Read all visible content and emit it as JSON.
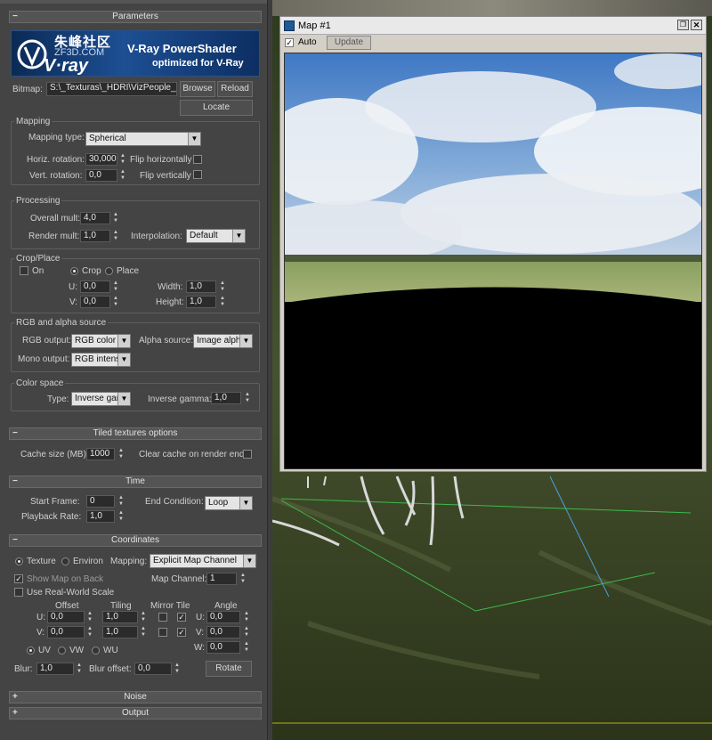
{
  "banner": {
    "brand_chinese": "朱峰社区",
    "brand_site": "ZF3D.COM",
    "logo_text": "V·ray",
    "product": "V-Ray PowerShader",
    "tagline": "optimized for V-Ray"
  },
  "parameters": {
    "header": "Parameters",
    "bitmap_label": "Bitmap:",
    "bitmap_path": "S:\\_Texturas\\_HDRI\\VizPeople_HD",
    "browse": "Browse",
    "reload": "Reload",
    "locate": "Locate"
  },
  "mapping": {
    "title": "Mapping",
    "type_label": "Mapping type:",
    "type_value": "Spherical",
    "horiz_label": "Horiz. rotation:",
    "horiz_value": "30,000",
    "flip_h": "Flip horizontally",
    "vert_label": "Vert. rotation:",
    "vert_value": "0,0",
    "flip_v": "Flip vertically"
  },
  "processing": {
    "title": "Processing",
    "overall_label": "Overall mult:",
    "overall_value": "4,0",
    "render_label": "Render mult:",
    "render_value": "1,0",
    "interp_label": "Interpolation:",
    "interp_value": "Default"
  },
  "crop": {
    "title": "Crop/Place",
    "on": "On",
    "crop": "Crop",
    "place": "Place",
    "u_label": "U:",
    "u_value": "0,0",
    "v_label": "V:",
    "v_value": "0,0",
    "width_label": "Width:",
    "width_value": "1,0",
    "height_label": "Height:",
    "height_value": "1,0"
  },
  "rgb": {
    "title": "RGB and alpha source",
    "rgb_label": "RGB output:",
    "rgb_value": "RGB color",
    "alpha_label": "Alpha source:",
    "alpha_value": "Image alpha",
    "mono_label": "Mono output:",
    "mono_value": "RGB intensity"
  },
  "colorspace": {
    "title": "Color space",
    "type_label": "Type:",
    "type_value": "Inverse gamma",
    "gamma_label": "Inverse gamma:",
    "gamma_value": "1,0"
  },
  "tiled": {
    "header": "Tiled textures options",
    "cache_label": "Cache size (MB):",
    "cache_value": "1000",
    "clear_label": "Clear cache on render end"
  },
  "time": {
    "header": "Time",
    "start_label": "Start Frame:",
    "start_value": "0",
    "rate_label": "Playback Rate:",
    "rate_value": "1,0",
    "end_label": "End Condition:",
    "end_value": "Loop"
  },
  "coordinates": {
    "header": "Coordinates",
    "texture": "Texture",
    "environ": "Environ",
    "mapping_label": "Mapping:",
    "mapping_value": "Explicit Map Channel",
    "show_map": "Show Map on Back",
    "map_channel_label": "Map Channel:",
    "map_channel_value": "1",
    "real_world": "Use Real-World Scale",
    "offset": "Offset",
    "tiling": "Tiling",
    "mirror_tile": "Mirror Tile",
    "angle": "Angle",
    "u": "U:",
    "v": "V:",
    "w": "W:",
    "offset_u": "0,0",
    "offset_v": "0,0",
    "tiling_u": "1,0",
    "tiling_v": "1,0",
    "angle_u": "0,0",
    "angle_v": "0,0",
    "angle_w": "0,0",
    "uv": "UV",
    "vw": "VW",
    "wu": "WU",
    "blur_label": "Blur:",
    "blur_value": "1,0",
    "blur_offset_label": "Blur offset:",
    "blur_offset_value": "0,0",
    "rotate": "Rotate"
  },
  "noise": {
    "header": "Noise"
  },
  "output": {
    "header": "Output"
  },
  "map_window": {
    "title": "Map #1",
    "auto": "Auto",
    "update": "Update"
  }
}
